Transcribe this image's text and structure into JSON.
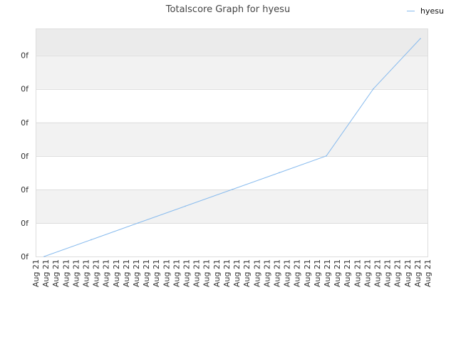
{
  "chart_data": {
    "type": "line",
    "title": "Totalscore Graph for hyesu",
    "xlabel": "",
    "ylabel": "",
    "x_tick_labels": [
      "Aug 21",
      "Aug 21",
      "Aug 21",
      "Aug 21",
      "Aug 21",
      "Aug 21",
      "Aug 21",
      "Aug 21",
      "Aug 21",
      "Aug 21",
      "Aug 21",
      "Aug 21",
      "Aug 21",
      "Aug 21",
      "Aug 21",
      "Aug 21",
      "Aug 21",
      "Aug 21",
      "Aug 21",
      "Aug 21",
      "Aug 21",
      "Aug 21",
      "Aug 21",
      "Aug 21",
      "Aug 21",
      "Aug 21",
      "Aug 21",
      "Aug 21",
      "Aug 21",
      "Aug 21",
      "Aug 21",
      "Aug 21",
      "Aug 21",
      "Aug 21",
      "Aug 21",
      "Aug 21",
      "Aug 21",
      "Aug 21",
      "Aug 21",
      "Aug 21"
    ],
    "y_tick_labels": [
      "0f",
      "0f",
      "0f",
      "0f",
      "0f",
      "0f",
      "0f"
    ],
    "ylim": [
      0,
      6.8
    ],
    "grid": true,
    "legend_position": "top-right",
    "colors": {
      "line": "#88bbee",
      "band": "#f2f2f2",
      "top_band": "#ebebeb",
      "grid": "#dddddd"
    },
    "series": [
      {
        "name": "hyesu",
        "x": [
          0,
          1,
          2,
          3,
          4,
          5,
          6,
          7,
          8
        ],
        "values": [
          0,
          0.5,
          1.0,
          1.5,
          2.0,
          2.5,
          3.0,
          5.0,
          6.5
        ]
      }
    ]
  }
}
